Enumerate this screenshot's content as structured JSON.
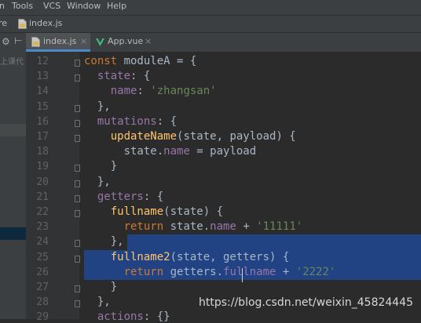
{
  "menu": [
    "n",
    "Tools",
    "VCS",
    "Window",
    "Help"
  ],
  "navbar": {
    "crumb_left": "re",
    "file": "index.js"
  },
  "sidebar_fragment": "上课代",
  "tabs": [
    {
      "label": "index.js",
      "close": "×"
    },
    {
      "label": "App.vue",
      "close": "×"
    }
  ],
  "lines": [
    {
      "n": "12",
      "t": [
        [
          "kw",
          "const "
        ],
        [
          "",
          "moduleA = {"
        ]
      ]
    },
    {
      "n": "13",
      "t": [
        [
          "",
          "  "
        ],
        [
          "prop",
          "state"
        ],
        [
          "",
          ": {"
        ]
      ]
    },
    {
      "n": "14",
      "t": [
        [
          "",
          "    "
        ],
        [
          "prop",
          "name"
        ],
        [
          "",
          ": "
        ],
        [
          "str",
          "'zhangsan'"
        ]
      ]
    },
    {
      "n": "15",
      "t": [
        [
          "",
          "  },"
        ]
      ]
    },
    {
      "n": "16",
      "t": [
        [
          "",
          "  "
        ],
        [
          "prop",
          "mutations"
        ],
        [
          "",
          ": {"
        ]
      ]
    },
    {
      "n": "17",
      "t": [
        [
          "",
          "    "
        ],
        [
          "fn",
          "updateName"
        ],
        [
          "",
          "(state, payload) {"
        ]
      ]
    },
    {
      "n": "18",
      "t": [
        [
          "",
          "      state."
        ],
        [
          "prop",
          "name"
        ],
        [
          "",
          " = payload"
        ]
      ]
    },
    {
      "n": "19",
      "t": [
        [
          "",
          "    }"
        ]
      ]
    },
    {
      "n": "20",
      "t": [
        [
          "",
          "  },"
        ]
      ]
    },
    {
      "n": "21",
      "t": [
        [
          "",
          "  "
        ],
        [
          "prop",
          "getters"
        ],
        [
          "",
          ": {"
        ]
      ]
    },
    {
      "n": "22",
      "t": [
        [
          "",
          "    "
        ],
        [
          "fn",
          "fullname"
        ],
        [
          "",
          "(state) {"
        ]
      ]
    },
    {
      "n": "23",
      "t": [
        [
          "",
          "      "
        ],
        [
          "kw",
          "return "
        ],
        [
          "",
          "state."
        ],
        [
          "prop",
          "name"
        ],
        [
          "",
          " + "
        ],
        [
          "str",
          "'11111'"
        ]
      ]
    },
    {
      "n": "24",
      "t": [
        [
          "",
          "    },"
        ]
      ]
    },
    {
      "n": "25",
      "t": [
        [
          "",
          "    "
        ],
        [
          "fn",
          "fullname2"
        ],
        [
          "",
          "(state, getters) {"
        ]
      ]
    },
    {
      "n": "26",
      "t": [
        [
          "",
          "      "
        ],
        [
          "kw",
          "return "
        ],
        [
          "",
          "getters."
        ],
        [
          "prop",
          "fullname"
        ],
        [
          "",
          " + "
        ],
        [
          "str",
          "'2222'"
        ]
      ]
    },
    {
      "n": "27",
      "t": [
        [
          "",
          "    }"
        ]
      ]
    },
    {
      "n": "28",
      "t": [
        [
          "",
          "  },"
        ]
      ]
    },
    {
      "n": "29",
      "t": [
        [
          "",
          "  "
        ],
        [
          "prop",
          "actions"
        ],
        [
          "",
          ": {}"
        ]
      ]
    }
  ],
  "watermark": "https://blog.csdn.net/weixin_45824445",
  "colors": {
    "keyword": "#cc7832",
    "function": "#ffc66d",
    "property": "#9876aa",
    "string": "#6a8759",
    "selection": "#214283"
  }
}
